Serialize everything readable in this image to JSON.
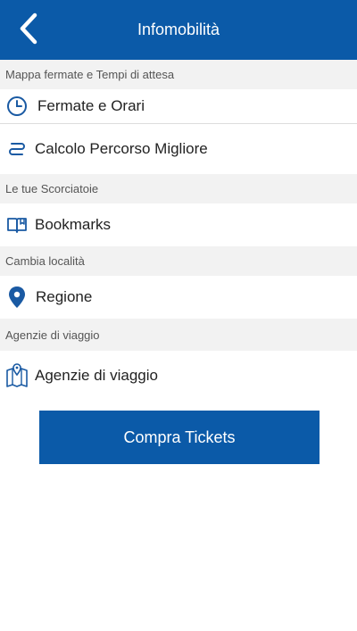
{
  "header": {
    "title": "Infomobilità",
    "back_icon": "chevron-left-icon",
    "color": "#0b5aa8"
  },
  "sections": {
    "stops": {
      "label": "Mappa fermate e Tempi di attesa",
      "items": [
        {
          "label": "Fermate e Orari",
          "icon": "clock-icon"
        },
        {
          "label": "Calcolo Percorso Migliore",
          "icon": "route-icon"
        }
      ]
    },
    "shortcuts": {
      "label": "Le tue Scorciatoie",
      "items": [
        {
          "label": "Bookmarks",
          "icon": "book-icon"
        }
      ]
    },
    "location": {
      "label": "Cambia località",
      "items": [
        {
          "label": "Regione",
          "icon": "location-pin-icon"
        }
      ]
    },
    "agencies": {
      "label": "Agenzie di viaggio",
      "items": [
        {
          "label": "Agenzie di viaggio",
          "icon": "map-pin-icon"
        }
      ]
    }
  },
  "cta": {
    "label": "Compra Tickets"
  }
}
